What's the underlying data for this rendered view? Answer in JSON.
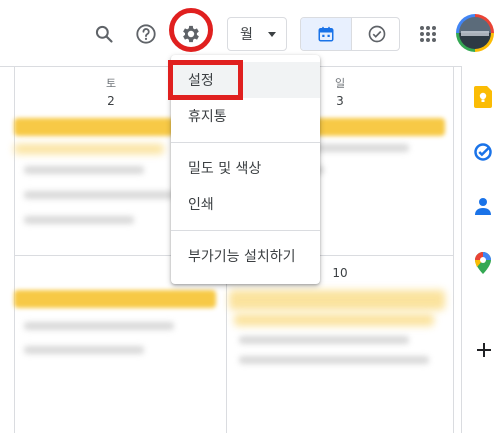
{
  "toolbar": {
    "search_icon": "search-icon",
    "help_icon": "help-icon",
    "settings_icon": "gear-icon",
    "view_select": "월",
    "calendar_view_icon": "calendar-icon",
    "tasks_view_icon": "check-circle-icon",
    "apps_icon": "apps-grid-icon",
    "accent": "#1a73e8"
  },
  "grid": {
    "headers": [
      {
        "day": "토",
        "date": "2"
      },
      {
        "day": "일",
        "date": "3"
      }
    ],
    "second_row_date": "10"
  },
  "settings_menu": {
    "items": [
      {
        "label": "설정",
        "highlighted": true
      },
      {
        "label": "휴지통"
      },
      {
        "label": "밀도 및 색상"
      },
      {
        "label": "인쇄"
      },
      {
        "label": "부가기능 설치하기"
      }
    ]
  },
  "side_panel": {
    "icons": [
      "keep-icon",
      "tasks-icon",
      "contacts-icon",
      "maps-icon",
      "add-icon"
    ],
    "keep_color": "#fbbc04",
    "tasks_color": "#1a73e8",
    "contacts_color": "#1a73e8"
  },
  "annotations": {
    "color": "#e0201f"
  }
}
